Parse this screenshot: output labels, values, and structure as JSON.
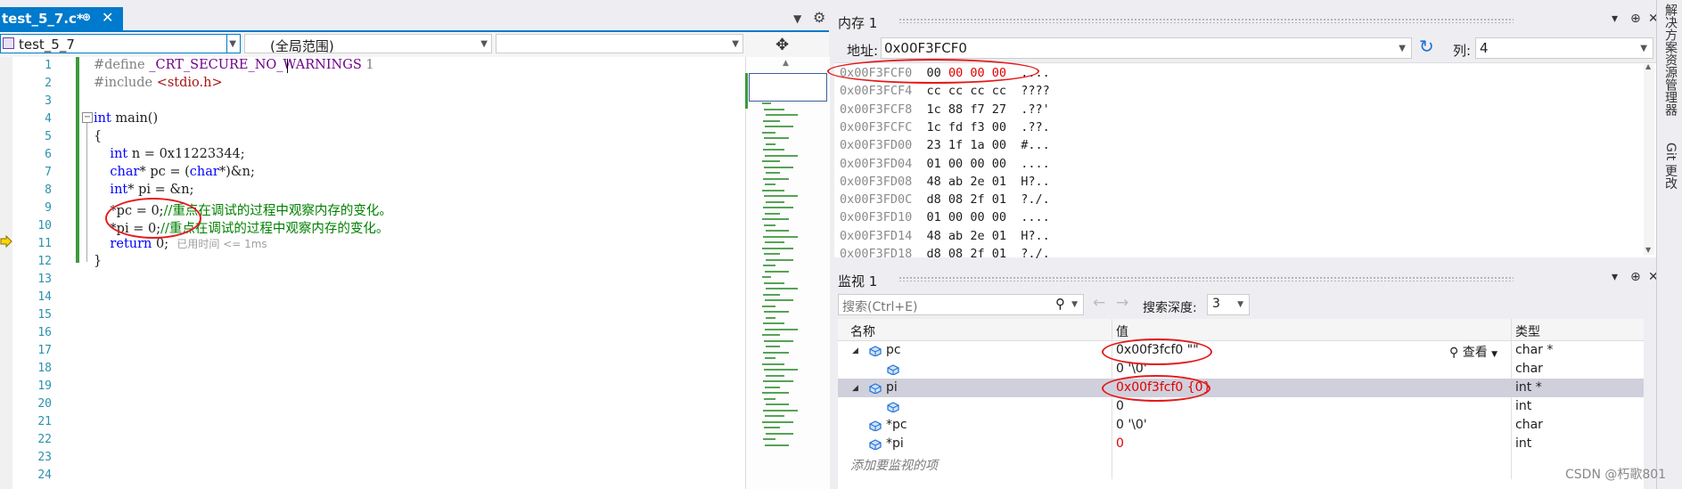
{
  "editor": {
    "tab_title": "test_5_7.c*",
    "tab_pin": "⊕",
    "tab_close": "✕",
    "project": "test_5_7",
    "scope": "(全局范围)",
    "function": "",
    "line_numbers": [
      "1",
      "2",
      "3",
      "4",
      "5",
      "6",
      "7",
      "8",
      "9",
      "10",
      "11",
      "12",
      "13",
      "14",
      "15",
      "16",
      "17",
      "18",
      "19",
      "20",
      "21",
      "22",
      "23",
      "24"
    ],
    "lines": {
      "l1_a": "#define ",
      "l1_b": "_CRT_SECURE_NO_WARNINGS",
      "l1_c": " 1",
      "l2_a": "#include ",
      "l2_b": "<stdio.h>",
      "l4_a": "int",
      "l4_b": " main()",
      "l5": "{",
      "l6_a": "    int",
      "l6_b": " n = 0x11223344;",
      "l7_a": "    char",
      "l7_b": "* pc = (",
      "l7_c": "char",
      "l7_d": "*)&n;",
      "l8_a": "    int",
      "l8_b": "* pi = &n;",
      "l9_a": "    *pc = 0;",
      "l9_b": "//重点在调试的过程中观察内存的变化。",
      "l10_a": "    *pi = 0;",
      "l10_b": "//重点在调试的过程中观察内存的变化。",
      "l11_a": "    return",
      "l11_b": " 0;",
      "l11_hint": "已用时间 <= 1ms",
      "l12": "}"
    }
  },
  "memory": {
    "title": "内存 1",
    "address_label": "地址:",
    "address_value": "0x00F3FCF0",
    "columns_label": "列:",
    "columns_value": "4",
    "rows": [
      {
        "addr": "0x00F3FCF0",
        "b1": "00",
        "rest": "00 00 00",
        "chars": "...."
      },
      {
        "addr": "0x00F3FCF4",
        "bytes": "cc cc cc cc",
        "chars": "????"
      },
      {
        "addr": "0x00F3FCF8",
        "bytes": "1c 88 f7 27",
        "chars": ".??'"
      },
      {
        "addr": "0x00F3FCFC",
        "bytes": "1c fd f3 00",
        "chars": ".??."
      },
      {
        "addr": "0x00F3FD00",
        "bytes": "23 1f 1a 00",
        "chars": "#..."
      },
      {
        "addr": "0x00F3FD04",
        "bytes": "01 00 00 00",
        "chars": "...."
      },
      {
        "addr": "0x00F3FD08",
        "bytes": "48 ab 2e 01",
        "chars": "H?.."
      },
      {
        "addr": "0x00F3FD0C",
        "bytes": "d8 08 2f 01",
        "chars": "?./."
      },
      {
        "addr": "0x00F3FD10",
        "bytes": "01 00 00 00",
        "chars": "...."
      },
      {
        "addr": "0x00F3FD14",
        "bytes": "48 ab 2e 01",
        "chars": "H?.."
      },
      {
        "addr": "0x00F3FD18",
        "bytes": "d8 08 2f 01",
        "chars": "?./."
      }
    ]
  },
  "watch": {
    "title": "监视 1",
    "search_placeholder": "搜索(Ctrl+E)",
    "depth_label": "搜索深度:",
    "depth_value": "3",
    "headers": {
      "name": "名称",
      "value": "值",
      "type": "类型"
    },
    "view_label": "查看",
    "rows": [
      {
        "name": "pc",
        "value": "0x00f3fcf0 \"\"",
        "type": "char *"
      },
      {
        "name": "",
        "value": "0 '\\0'",
        "type": "char"
      },
      {
        "name": "pi",
        "value": "0x00f3fcf0 {0}",
        "type": "int *"
      },
      {
        "name": "",
        "value": "0",
        "type": "int"
      },
      {
        "name": "*pc",
        "value": "0 '\\0'",
        "type": "char"
      },
      {
        "name": "*pi",
        "value": "0",
        "type": "int"
      }
    ],
    "add_watch": "添加要监视的项"
  },
  "side_tabs": [
    "解决方案资源管理器",
    "Git 更改"
  ],
  "watermark": "CSDN @朽歌801",
  "colors": {
    "accent": "#007acc",
    "annotation": "#e31b1b",
    "changed": "#e00000"
  }
}
